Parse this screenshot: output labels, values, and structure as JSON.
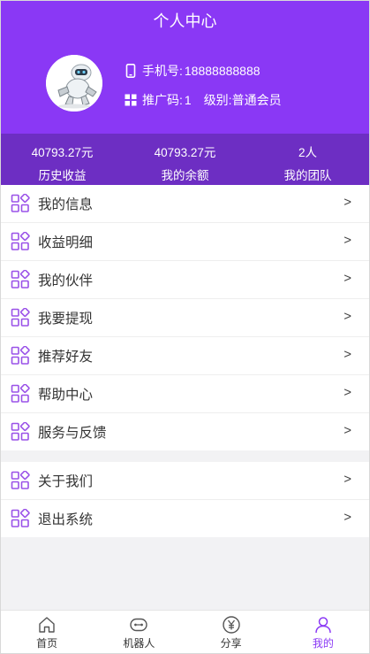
{
  "header": {
    "title": "个人中心",
    "phone_label": "手机号:",
    "phone": "18888888888",
    "referral_label": "推广码:",
    "referral_code": "1",
    "level_label": "级别:",
    "level": "普通会员"
  },
  "stats": [
    {
      "value": "40793.27元",
      "label": "历史收益"
    },
    {
      "value": "40793.27元",
      "label": "我的余额"
    },
    {
      "value": "2人",
      "label": "我的团队"
    }
  ],
  "menu_primary": [
    {
      "label": "我的信息"
    },
    {
      "label": "收益明细"
    },
    {
      "label": "我的伙伴"
    },
    {
      "label": "我要提现"
    },
    {
      "label": "推荐好友"
    },
    {
      "label": "帮助中心"
    },
    {
      "label": "服务与反馈"
    }
  ],
  "menu_secondary": [
    {
      "label": "关于我们"
    },
    {
      "label": "退出系统"
    }
  ],
  "arrow": ">",
  "tabbar": [
    {
      "label": "首页",
      "icon": "home-icon"
    },
    {
      "label": "机器人",
      "icon": "robot-icon"
    },
    {
      "label": "分享",
      "icon": "yen-icon"
    },
    {
      "label": "我的",
      "icon": "user-icon",
      "active": true
    }
  ],
  "colors": {
    "brand": "#8a38f5",
    "brand_dark": "#6d2ec3",
    "icon": "#9a52e8"
  }
}
